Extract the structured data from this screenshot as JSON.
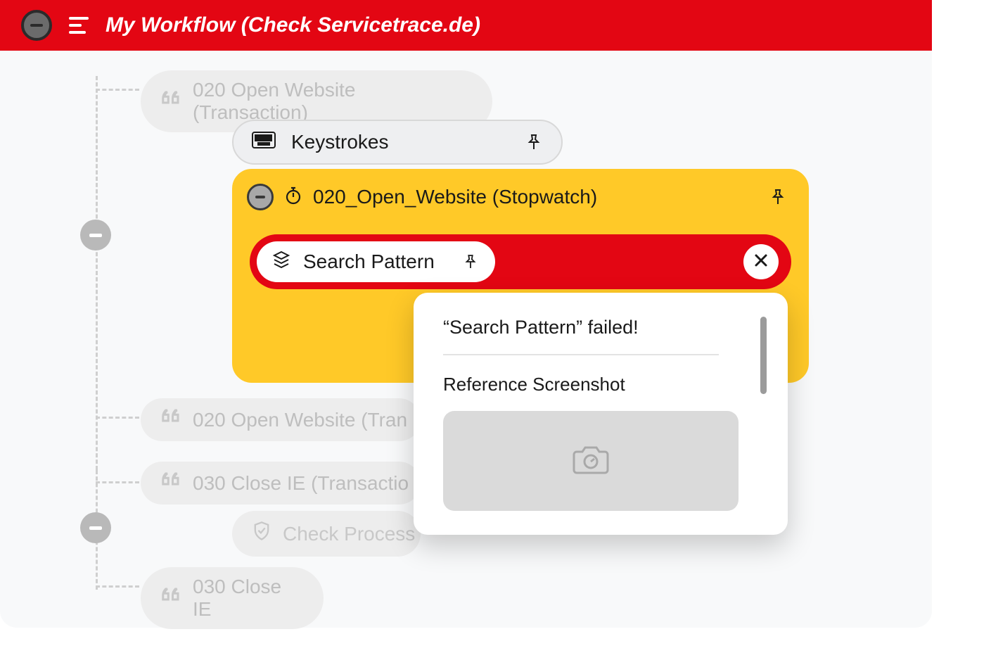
{
  "colors": {
    "brand_red": "#E30613",
    "accent_yellow": "#FFC928",
    "bg": "#F8F9FA",
    "faded_grey": "#EDEDED",
    "faded_text": "#BEBEBE"
  },
  "titlebar": {
    "title": "My Workflow (Check Servicetrace.de)"
  },
  "tree": {
    "node1": {
      "label": "020 Open Website (Transaction)"
    },
    "keystrokes": {
      "label": "Keystrokes"
    },
    "stopwatch": {
      "label": "020_Open_Website (Stopwatch)"
    },
    "search_pattern": {
      "label": "Search Pattern"
    },
    "node2_dup": {
      "label": "020 Open Website (Tran"
    },
    "node3": {
      "label": "030 Close IE (Transactio"
    },
    "check_process": {
      "label": "Check Process"
    },
    "node4": {
      "label": "030 Close IE"
    }
  },
  "popover": {
    "headline": "“Search Pattern” failed!",
    "subhead": "Reference Screenshot"
  },
  "icons": {
    "quote": "quote-icon",
    "keyboard": "keyboard-icon",
    "stopwatch": "stopwatch-icon",
    "layers": "layers-icon",
    "pin": "pin-icon",
    "close": "close-icon",
    "shield": "shield-check-icon",
    "camera": "camera-icon"
  }
}
